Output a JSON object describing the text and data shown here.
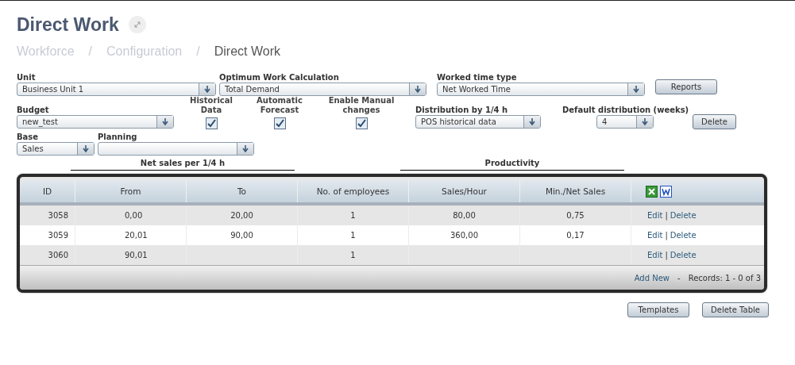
{
  "page": {
    "title": "Direct Work"
  },
  "breadcrumb": [
    {
      "label": "Workforce",
      "current": false
    },
    {
      "label": "Configuration",
      "current": false
    },
    {
      "label": "Direct Work",
      "current": true
    }
  ],
  "breadcrumb_separator": "/",
  "form": {
    "unit": {
      "label": "Unit",
      "value": "Business Unit 1"
    },
    "optimum": {
      "label": "Optimum Work Calculation",
      "value": "Total Demand"
    },
    "worked_time_type": {
      "label": "Worked time type",
      "value": "Net Worked Time"
    },
    "reports_button": "Reports",
    "budget": {
      "label": "Budget",
      "value": "new_test"
    },
    "checkboxes": [
      {
        "label": "Historical Data",
        "checked": true
      },
      {
        "label": "Automatic Forecast",
        "checked": true
      },
      {
        "label": "Enable Manual changes",
        "checked": true
      }
    ],
    "distribution": {
      "label": "Distribution by 1/4 h",
      "value": "POS historical data"
    },
    "default_distribution": {
      "label": "Default distribution (weeks)",
      "value": "4"
    },
    "delete_button": "Delete",
    "base": {
      "label": "Base",
      "value": "Sales"
    },
    "planning": {
      "label": "Planning"
    }
  },
  "section_headers": [
    "Net sales per 1/4 h",
    "Productivity"
  ],
  "table": {
    "columns": [
      "ID",
      "From",
      "To",
      "No. of employees",
      "Sales/Hour",
      "Min./Net Sales"
    ],
    "rows": [
      {
        "cells": [
          "3058",
          "0,00",
          "20,00",
          "1",
          "80,00",
          "0,75"
        ],
        "edit": "Edit",
        "delete": "Delete"
      },
      {
        "cells": [
          "3059",
          "20,01",
          "90,00",
          "1",
          "360,00",
          "0,17"
        ],
        "edit": "Edit",
        "delete": "Delete"
      },
      {
        "cells": [
          "3060",
          "90,01",
          "",
          "1",
          "",
          ""
        ],
        "edit": "Edit",
        "delete": "Delete"
      }
    ],
    "action_separator": "|",
    "add_new": "Add New",
    "footer_dash": "-",
    "records": "Records: 1 - 0 of 3"
  },
  "buttons": [
    "Templates",
    "Delete Table"
  ]
}
